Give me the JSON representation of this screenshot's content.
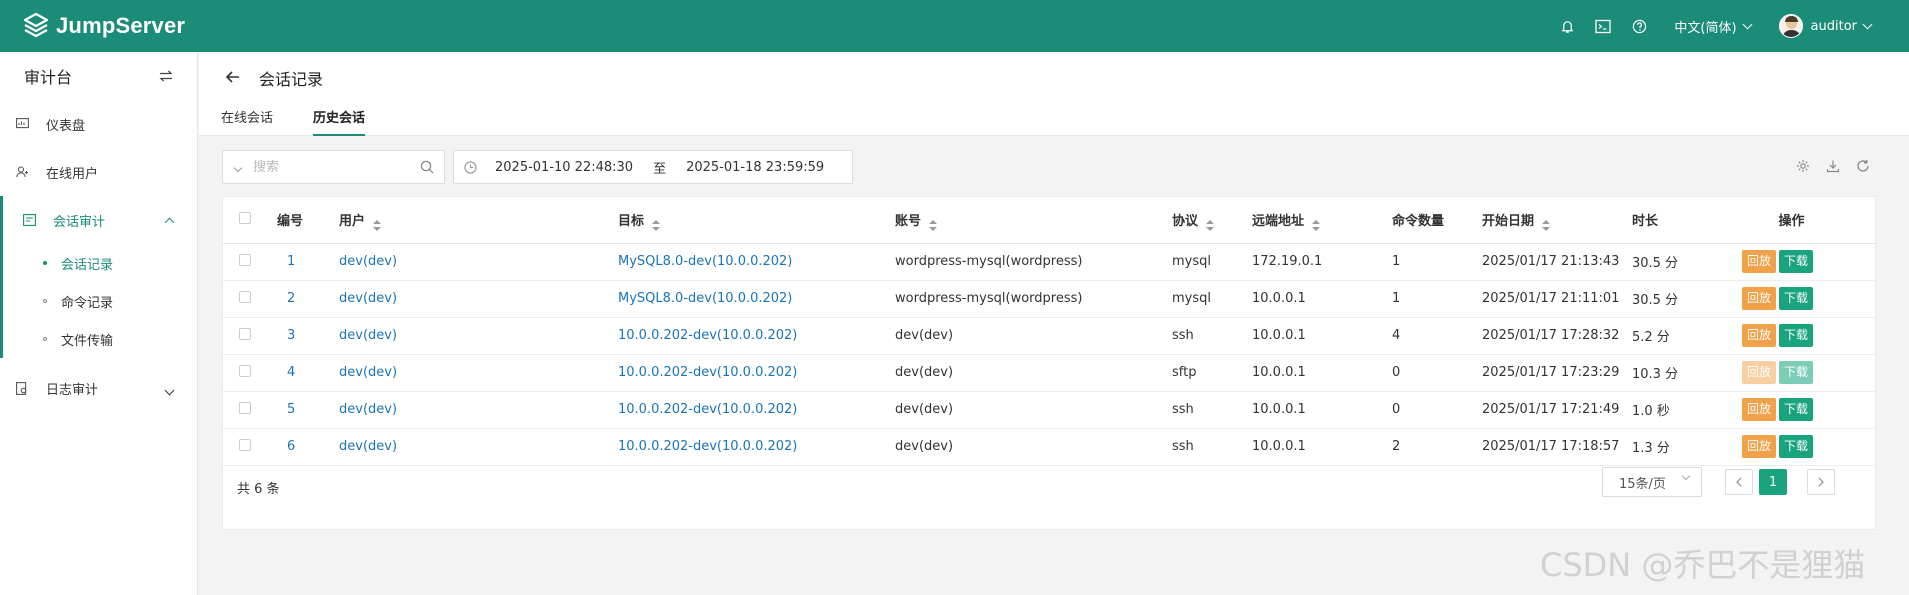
{
  "app": {
    "name": "JumpServer"
  },
  "topbar": {
    "language": "中文(简体)",
    "user": "auditor"
  },
  "sidebar": {
    "title": "审计台",
    "items": [
      {
        "label": "仪表盘"
      },
      {
        "label": "在线用户"
      },
      {
        "label": "会话审计",
        "sub": [
          {
            "label": "会话记录"
          },
          {
            "label": "命令记录"
          },
          {
            "label": "文件传输"
          }
        ]
      },
      {
        "label": "日志审计"
      }
    ]
  },
  "page": {
    "title": "会话记录",
    "tabs": [
      {
        "label": "在线会话"
      },
      {
        "label": "历史会话"
      }
    ]
  },
  "filters": {
    "search_placeholder": "搜索",
    "date_start": "2025-01-10 22:48:30",
    "date_sep": "至",
    "date_end": "2025-01-18 23:59:59"
  },
  "table": {
    "headers": [
      "编号",
      "用户",
      "目标",
      "账号",
      "协议",
      "远端地址",
      "命令数量",
      "开始日期",
      "时长",
      "操作"
    ],
    "rows": [
      {
        "id": "1",
        "user": "dev(dev)",
        "target": "MySQL8.0-dev(10.0.0.202)",
        "account": "wordpress-mysql(wordpress)",
        "protocol": "mysql",
        "remote": "172.19.0.1",
        "cmds": "1",
        "start": "2025/01/17 21:13:43",
        "duration": "30.5 分",
        "replay": "回放",
        "download": "下载"
      },
      {
        "id": "2",
        "user": "dev(dev)",
        "target": "MySQL8.0-dev(10.0.0.202)",
        "account": "wordpress-mysql(wordpress)",
        "protocol": "mysql",
        "remote": "10.0.0.1",
        "cmds": "1",
        "start": "2025/01/17 21:11:01",
        "duration": "30.5 分",
        "replay": "回放",
        "download": "下载"
      },
      {
        "id": "3",
        "user": "dev(dev)",
        "target": "10.0.0.202-dev(10.0.0.202)",
        "account": "dev(dev)",
        "protocol": "ssh",
        "remote": "10.0.0.1",
        "cmds": "4",
        "start": "2025/01/17 17:28:32",
        "duration": "5.2 分",
        "replay": "回放",
        "download": "下载"
      },
      {
        "id": "4",
        "user": "dev(dev)",
        "target": "10.0.0.202-dev(10.0.0.202)",
        "account": "dev(dev)",
        "protocol": "sftp",
        "remote": "10.0.0.1",
        "cmds": "0",
        "start": "2025/01/17 17:23:29",
        "duration": "10.3 分",
        "replay": "回放",
        "download": "下载",
        "disabled": true
      },
      {
        "id": "5",
        "user": "dev(dev)",
        "target": "10.0.0.202-dev(10.0.0.202)",
        "account": "dev(dev)",
        "protocol": "ssh",
        "remote": "10.0.0.1",
        "cmds": "0",
        "start": "2025/01/17 17:21:49",
        "duration": "1.0 秒",
        "replay": "回放",
        "download": "下载"
      },
      {
        "id": "6",
        "user": "dev(dev)",
        "target": "10.0.0.202-dev(10.0.0.202)",
        "account": "dev(dev)",
        "protocol": "ssh",
        "remote": "10.0.0.1",
        "cmds": "2",
        "start": "2025/01/17 17:18:57",
        "duration": "1.3 分",
        "replay": "回放",
        "download": "下载"
      }
    ]
  },
  "pagination": {
    "total": "共 6 条",
    "page_size": "15条/页",
    "current": "1"
  },
  "watermark": "CSDN @乔巴不是狸猫",
  "colors": {
    "brand": "#1a8c77",
    "link": "#1a74b8",
    "replay": "#f0a14a",
    "download": "#1aa37f"
  }
}
